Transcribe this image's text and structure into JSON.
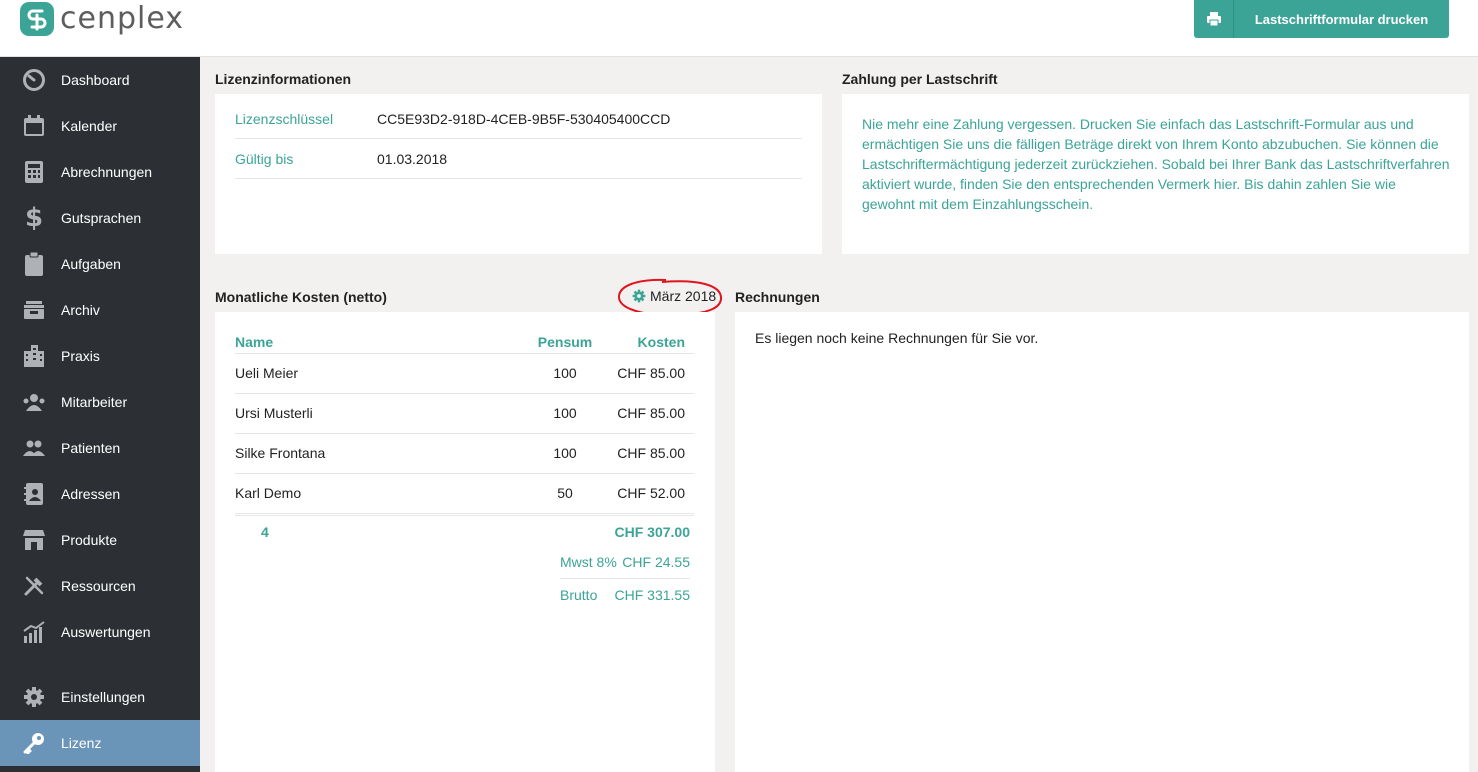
{
  "brand": {
    "name": "cenplex",
    "accent": "#3ba497"
  },
  "header": {
    "print_button_label": "Lastschriftformular drucken",
    "print_icon": "printer-icon"
  },
  "sidebar": {
    "items": [
      {
        "label": "Dashboard",
        "icon": "dashboard-icon"
      },
      {
        "label": "Kalender",
        "icon": "calendar-icon"
      },
      {
        "label": "Abrechnungen",
        "icon": "calculator-icon"
      },
      {
        "label": "Gutsprachen",
        "icon": "dollar-icon"
      },
      {
        "label": "Aufgaben",
        "icon": "clipboard-icon"
      },
      {
        "label": "Archiv",
        "icon": "archive-icon"
      },
      {
        "label": "Praxis",
        "icon": "building-icon"
      },
      {
        "label": "Mitarbeiter",
        "icon": "staff-icon"
      },
      {
        "label": "Patienten",
        "icon": "patients-icon"
      },
      {
        "label": "Adressen",
        "icon": "address-book-icon"
      },
      {
        "label": "Produkte",
        "icon": "shop-icon"
      },
      {
        "label": "Ressourcen",
        "icon": "tools-icon"
      },
      {
        "label": "Auswertungen",
        "icon": "chart-icon"
      },
      {
        "label": "Einstellungen",
        "icon": "gear-icon"
      },
      {
        "label": "Lizenz",
        "icon": "key-icon",
        "active": true
      }
    ]
  },
  "license": {
    "title": "Lizenzinformationen",
    "key_label": "Lizenzschlüssel",
    "key_value": "CC5E93D2-918D-4CEB-9B5F-530405400CCD",
    "valid_label": "Gültig bis",
    "valid_value": "01.03.2018"
  },
  "payment": {
    "title": "Zahlung per Lastschrift",
    "text": "Nie mehr eine Zahlung vergessen. Drucken Sie einfach das Lastschrift-Formular aus und ermächtigen Sie uns die fälligen Beträge direkt von Ihrem Konto abzubuchen. Sie können die Lastschriftermächtigung jederzeit zurückziehen. Sobald bei Ihrer Bank das Lastschriftverfahren aktiviert wurde, finden Sie den entsprechenden Vermerk hier. Bis dahin zahlen Sie wie gewohnt mit dem Einzahlungsschein."
  },
  "costs": {
    "title": "Monatliche Kosten (netto)",
    "month": "März 2018",
    "headers": {
      "name": "Name",
      "pensum": "Pensum",
      "kosten": "Kosten"
    },
    "rows": [
      {
        "name": "Ueli  Meier",
        "pensum": "100",
        "kosten": "CHF 85.00"
      },
      {
        "name": "Ursi Musterli",
        "pensum": "100",
        "kosten": "CHF 85.00"
      },
      {
        "name": "Silke Frontana",
        "pensum": "100",
        "kosten": "CHF 85.00"
      },
      {
        "name": "Karl Demo",
        "pensum": "50",
        "kosten": "CHF 52.00"
      }
    ],
    "count": "4",
    "total": "CHF 307.00",
    "vat_label": "Mwst 8%",
    "vat_value": "CHF 24.55",
    "gross_label": "Brutto",
    "gross_value": "CHF 331.55"
  },
  "invoices": {
    "title": "Rechnungen",
    "empty_text": "Es liegen noch keine Rechnungen für Sie vor."
  }
}
